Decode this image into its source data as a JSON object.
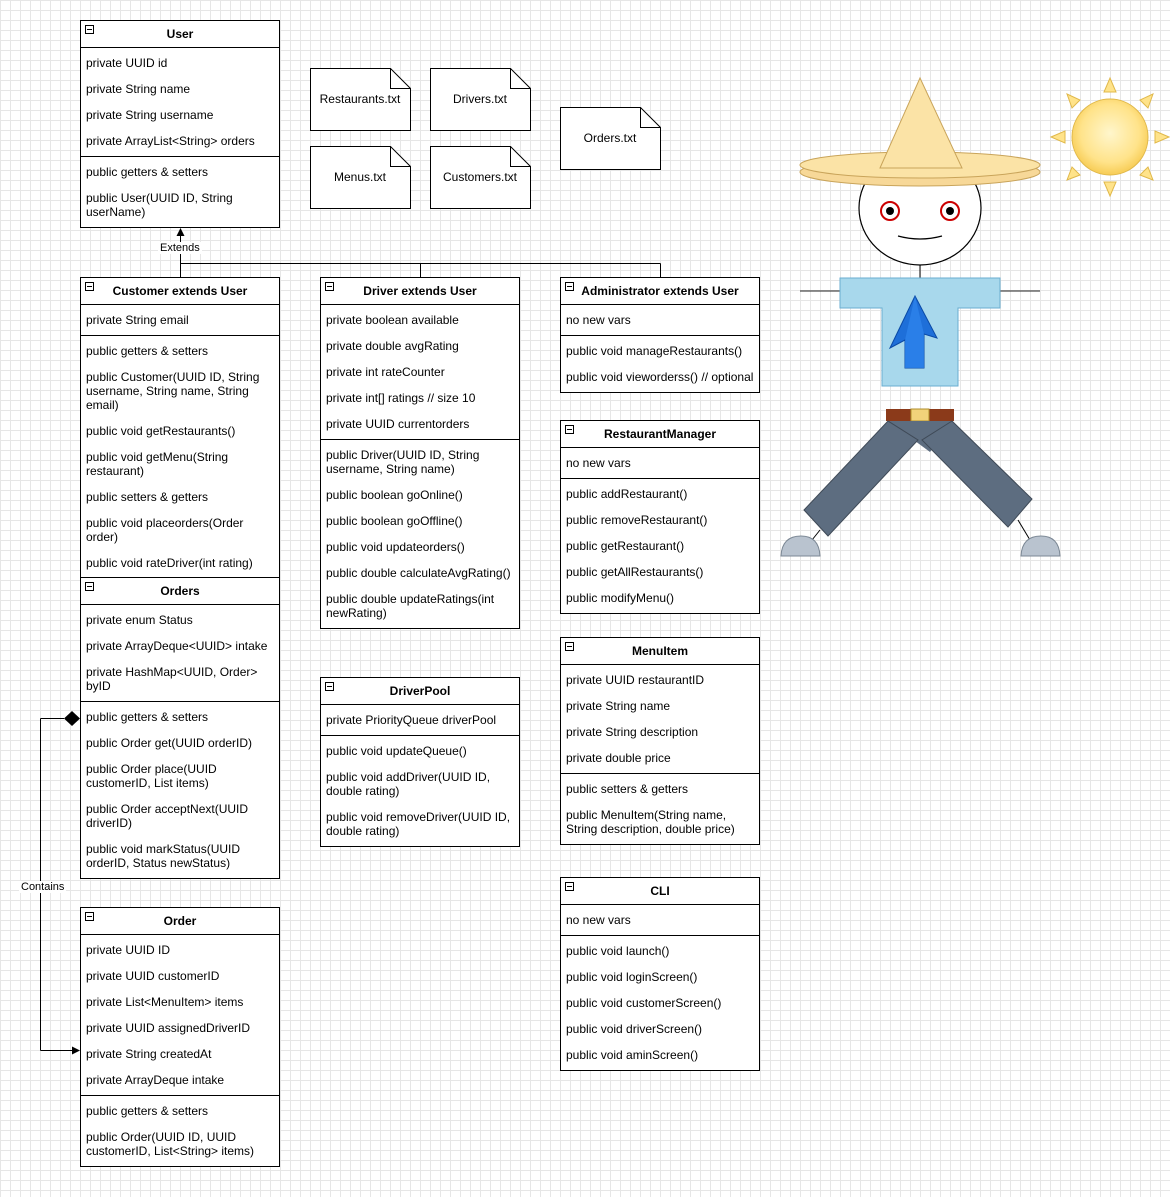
{
  "classes": {
    "user": {
      "title": "User",
      "attributes": [
        "private UUID id",
        "private String name",
        "private String username",
        "private ArrayList<String> orders"
      ],
      "methods": [
        "public getters & setters",
        "public User(UUID ID, String userName)"
      ]
    },
    "customer": {
      "title": "Customer extends User",
      "attributes": [
        "private String email"
      ],
      "methods": [
        "public getters & setters",
        "public Customer(UUID ID, String username, String name, String email)",
        "public void getRestaurants()",
        "public void getMenu(String restaurant)",
        "public setters & getters",
        "public void placeorders(Order order)",
        "public void rateDriver(int rating)"
      ]
    },
    "driver": {
      "title": "Driver extends User",
      "attributes": [
        "private boolean available",
        "private double avgRating",
        "private int rateCounter",
        "private int[] ratings // size 10",
        "private UUID currentorders"
      ],
      "methods": [
        "public Driver(UUID ID, String username, String name)",
        "public boolean goOnline()",
        "public boolean goOffline()",
        "public void updateorders()",
        "public double calculateAvgRating()",
        "public double updateRatings(int newRating)"
      ]
    },
    "administrator": {
      "title": "Administrator extends User",
      "attributes": [
        "no new vars"
      ],
      "methods": [
        "public void manageRestaurants()",
        "public void vieworderss() // optional"
      ]
    },
    "restaurant_manager": {
      "title": "RestaurantManager",
      "attributes": [
        "no new vars"
      ],
      "methods": [
        "public addRestaurant()",
        "public removeRestaurant()",
        "public getRestaurant()",
        "public getAllRestaurants()",
        "public modifyMenu()"
      ]
    },
    "orders": {
      "title": "Orders",
      "attributes": [
        "private enum Status",
        "private ArrayDeque<UUID> intake",
        "private HashMap<UUID, Order> byID"
      ],
      "methods": [
        "public getters & setters",
        "public Order get(UUID orderID)",
        "public Order place(UUID customerID, List items)",
        "public Order acceptNext(UUID driverID)",
        "public void markStatus(UUID orderID, Status newStatus)"
      ]
    },
    "driver_pool": {
      "title": "DriverPool",
      "attributes": [
        "private PriorityQueue driverPool"
      ],
      "methods": [
        "public void updateQueue()",
        "public void addDriver(UUID ID, double rating)",
        "public void removeDriver(UUID ID, double rating)"
      ]
    },
    "menu_item": {
      "title": "MenuItem",
      "attributes": [
        "private UUID restaurantID",
        "private String name",
        "private String description",
        "private double price"
      ],
      "methods": [
        "public setters & getters",
        "public MenuItem(String name, String description, double price)"
      ]
    },
    "cli": {
      "title": "CLI",
      "attributes": [
        "no new vars"
      ],
      "methods": [
        "public void launch()",
        "public void loginScreen()",
        "public void customerScreen()",
        "public void driverScreen()",
        "public void aminScreen()"
      ]
    },
    "order": {
      "title": "Order",
      "attributes": [
        "private UUID ID",
        "private UUID customerID",
        "private List<MenuItem> items",
        "private UUID assignedDriverID",
        "private String createdAt",
        "private ArrayDeque intake"
      ],
      "methods": [
        "public getters & setters",
        "public Order(UUID ID, UUID customerID, List<String> items)"
      ]
    }
  },
  "files": {
    "restaurants": "Restaurants.txt",
    "drivers": "Drivers.txt",
    "orders": "Orders.txt",
    "menus": "Menus.txt",
    "customers": "Customers.txt"
  },
  "edges": {
    "extends_label": "Extends",
    "contains_label": "Contains"
  },
  "illustration": {
    "figure": "scarecrow-icon",
    "sun": "sun-icon",
    "shirt_accent": "#1e6fd9",
    "hat_color": "#fbe3a6",
    "shirt_color": "#a8d8ec",
    "pants_color": "#5d6d80"
  }
}
